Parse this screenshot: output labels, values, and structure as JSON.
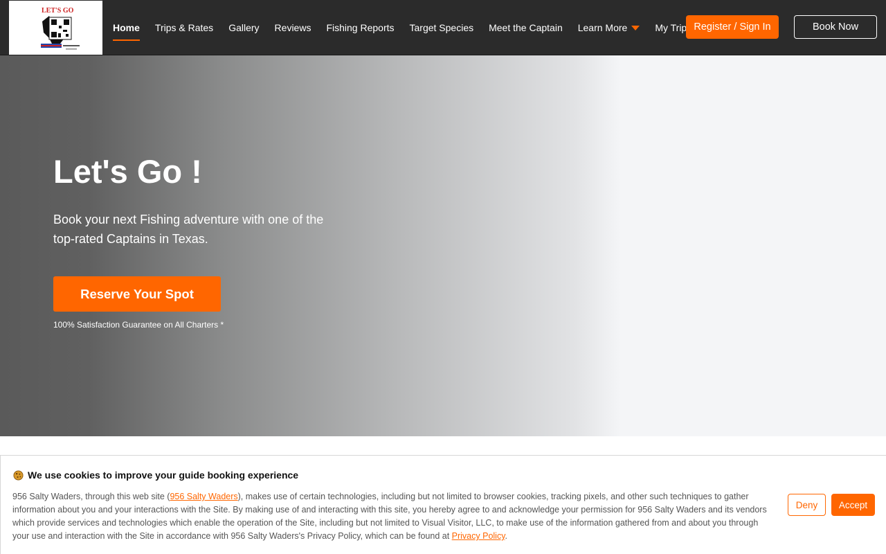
{
  "logo": {
    "text": "LET'S GO"
  },
  "nav": {
    "items": [
      {
        "label": "Home"
      },
      {
        "label": "Trips & Rates"
      },
      {
        "label": "Gallery"
      },
      {
        "label": "Reviews"
      },
      {
        "label": "Fishing Reports"
      },
      {
        "label": "Target Species"
      },
      {
        "label": "Meet the Captain"
      },
      {
        "label": "Learn More"
      },
      {
        "label": "My Trips"
      }
    ],
    "register_label": "Register / Sign In",
    "book_label": "Book Now"
  },
  "hero": {
    "title": "Let's Go !",
    "subtitle": "Book your next Fishing adventure with one of the top-rated Captains in Texas.",
    "cta_label": "Reserve Your Spot",
    "guarantee": "100% Satisfaction Guarantee on All Charters *"
  },
  "cookie": {
    "heading": "We use cookies to improve your guide booking experience",
    "body_part1": "956 Salty Waders, through this web site (",
    "site_link": "956 Salty Waders",
    "body_part2": "), makes use of certain technologies, including but not limited to browser cookies, tracking pixels, and other such techniques to gather information about you and your interactions with the Site. By making use of and interacting with this site, you hereby agree to and acknowledge your permission for 956 Salty Waders and its vendors which provide services and technologies which enable the operation of the Site, including but not limited to Visual Visitor, LLC, to make use of the information gathered from and about you through your use and interaction with the Site in accordance with 956 Salty Waders's Privacy Policy, which can be found at ",
    "policy_link": "Privacy Policy",
    "body_end": ".",
    "deny_label": "Deny",
    "accept_label": "Accept"
  },
  "colors": {
    "accent": "#ff6600",
    "header_bg": "#2b2b2b"
  }
}
